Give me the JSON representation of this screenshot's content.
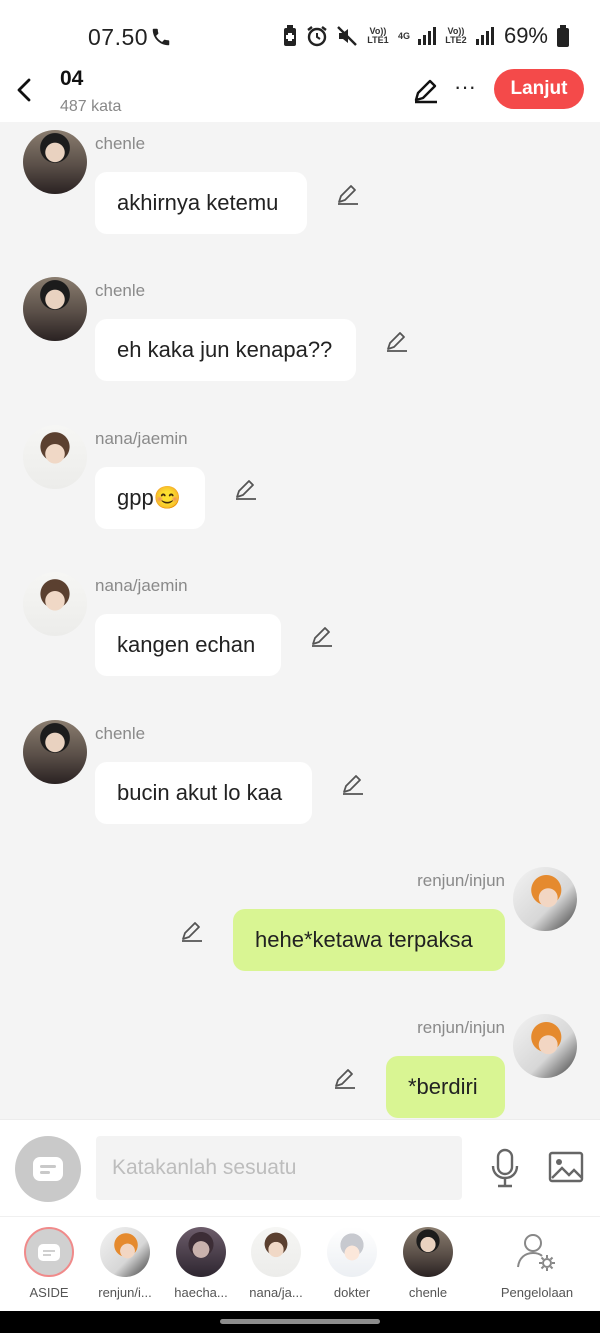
{
  "status_bar": {
    "time": "07.50",
    "volte1": "Vo)) LTE1",
    "net_4g": "4G",
    "volte2": "Vo)) LTE2",
    "battery": "69%"
  },
  "header": {
    "title": "04",
    "word_count": "487 kata",
    "continue_label": "Lanjut",
    "more_label": "···"
  },
  "messages": [
    {
      "sender": "chenle",
      "text": "akhirnya ketemu",
      "side": "left"
    },
    {
      "sender": "chenle",
      "text": "eh kaka jun kenapa??",
      "side": "left"
    },
    {
      "sender": "nana/jaemin",
      "text": "gpp😊",
      "side": "left"
    },
    {
      "sender": "nana/jaemin",
      "text": "kangen echan",
      "side": "left"
    },
    {
      "sender": "chenle",
      "text": "bucin akut lo kaa",
      "side": "left"
    },
    {
      "sender": "renjun/injun",
      "text": "hehe*ketawa terpaksa",
      "side": "right"
    },
    {
      "sender": "renjun/injun",
      "text": "*berdiri",
      "side": "right"
    }
  ],
  "input": {
    "placeholder": "Katakanlah sesuatu"
  },
  "characters": [
    {
      "label": "ASIDE"
    },
    {
      "label": "renjun/i..."
    },
    {
      "label": "haecha..."
    },
    {
      "label": "nana/ja..."
    },
    {
      "label": "dokter"
    },
    {
      "label": "chenle"
    },
    {
      "label": "Pengelolaan"
    }
  ],
  "colors": {
    "accent": "#f44a4a",
    "my_bubble": "#d9f593",
    "other_bubble": "#ffffff",
    "chat_background": "#f4f4f4"
  }
}
